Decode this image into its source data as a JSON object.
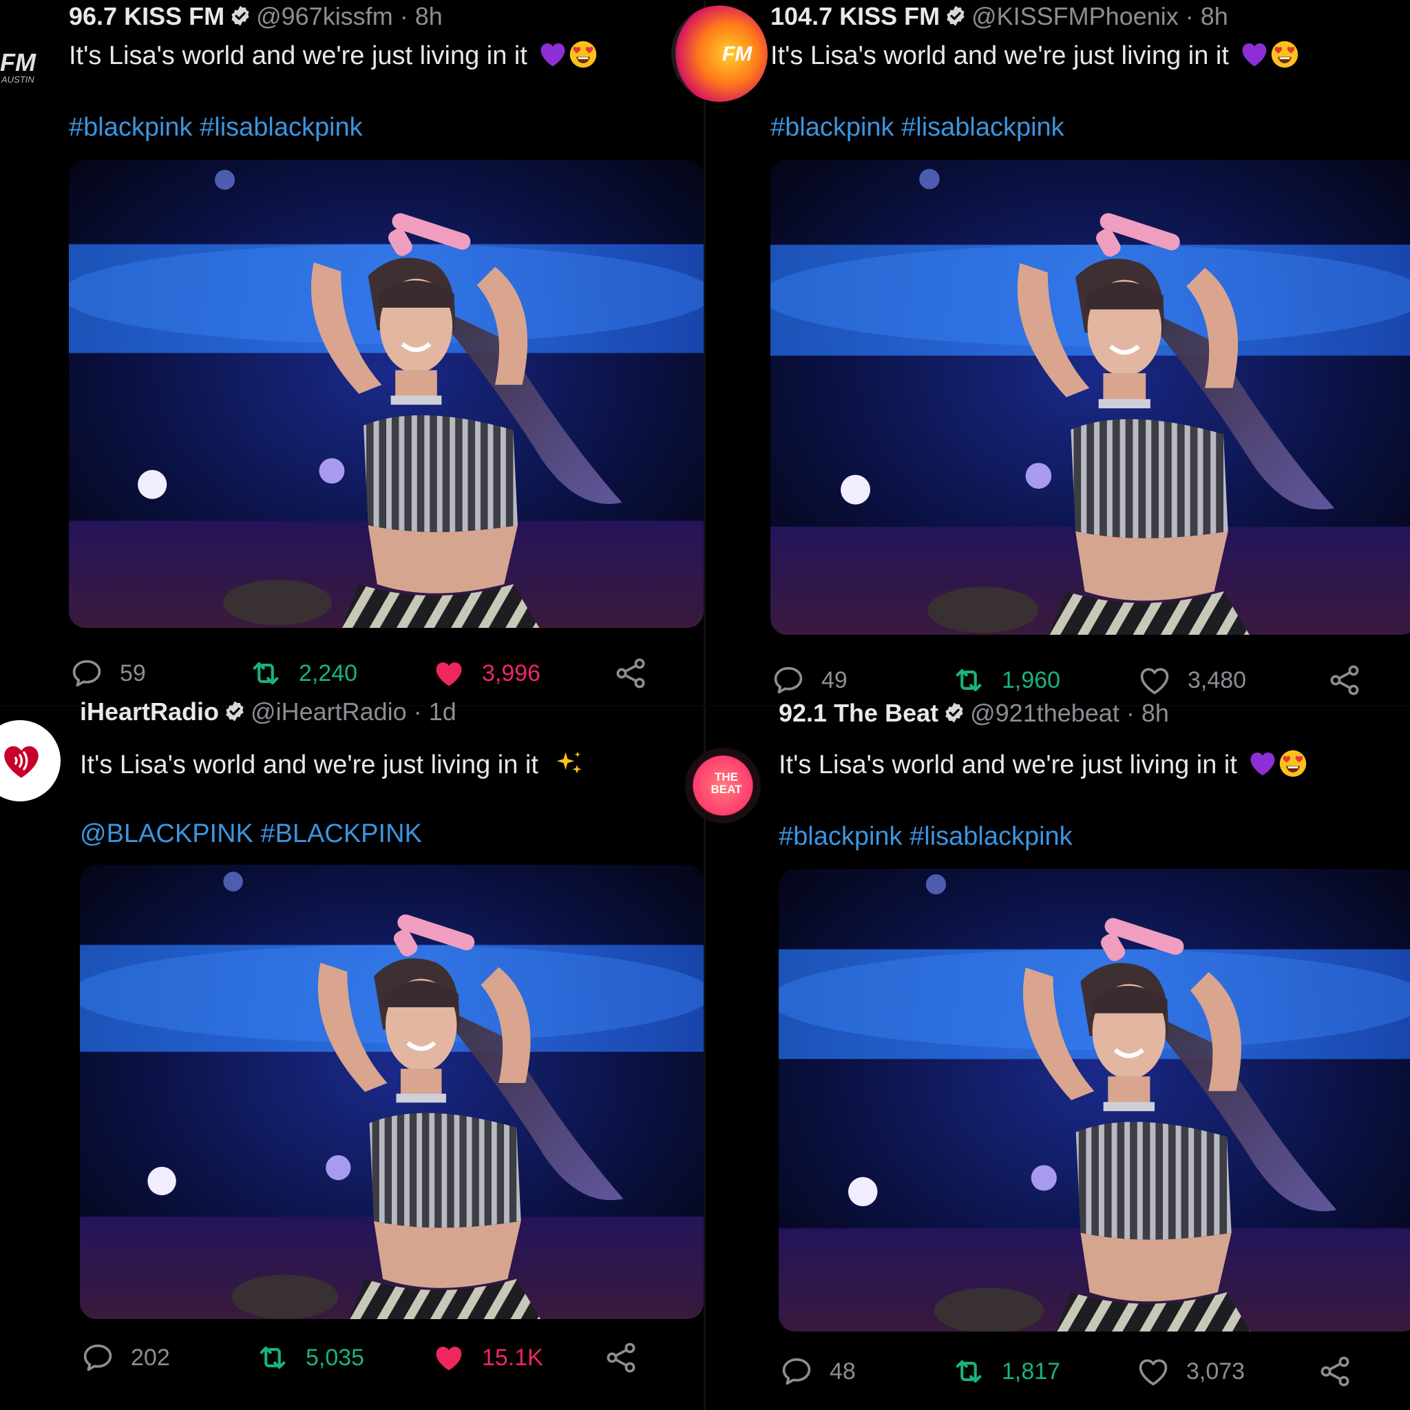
{
  "tweets": [
    {
      "name": "96.7 KISS FM",
      "handle": "@967kissfm",
      "time": "· 8h",
      "text": "It's Lisa's world and we're just living in it",
      "emoji": [
        "purple-heart",
        "heart-eyes"
      ],
      "tags": "#blackpink #lisablackpink",
      "avatar_text": "FM",
      "avatar_subtext": "AUSTIN",
      "replies": "59",
      "retweets": "2,240",
      "likes": "3,996",
      "liked": true
    },
    {
      "name": "104.7 KISS FM",
      "handle": "@KISSFMPhoenix",
      "time": "· 8h",
      "text": "It's Lisa's world and we're just living in it",
      "emoji": [
        "purple-heart",
        "heart-eyes"
      ],
      "tags": "#blackpink #lisablackpink",
      "avatar_text": "FM",
      "replies": "49",
      "retweets": "1,960",
      "likes": "3,480",
      "liked": false
    },
    {
      "name": "iHeartRadio",
      "handle": "@iHeartRadio",
      "time": "· 1d",
      "text": "It's Lisa's world and we're just living in it",
      "emoji": [
        "sparkles"
      ],
      "tags": "@BLACKPINK #BLACKPINK",
      "replies": "202",
      "retweets": "5,035",
      "likes": "15.1K",
      "liked": true
    },
    {
      "name": "92.1 The Beat",
      "handle": "@921thebeat",
      "time": "· 8h",
      "text": "It's Lisa's world and we're just living in it",
      "emoji": [
        "purple-heart",
        "heart-eyes"
      ],
      "tags": "#blackpink #lisablackpink",
      "avatar_text": "THE BEAT",
      "replies": "48",
      "retweets": "1,817",
      "likes": "3,073",
      "liked": false
    }
  ],
  "colors": {
    "background": "#000000",
    "link": "#3b95e0",
    "retweet": "#19b47a",
    "like": "#f0265f",
    "muted": "#8b8f94"
  },
  "icons": [
    "reply-icon",
    "retweet-icon",
    "like-icon",
    "share-icon",
    "verified-badge-icon"
  ]
}
